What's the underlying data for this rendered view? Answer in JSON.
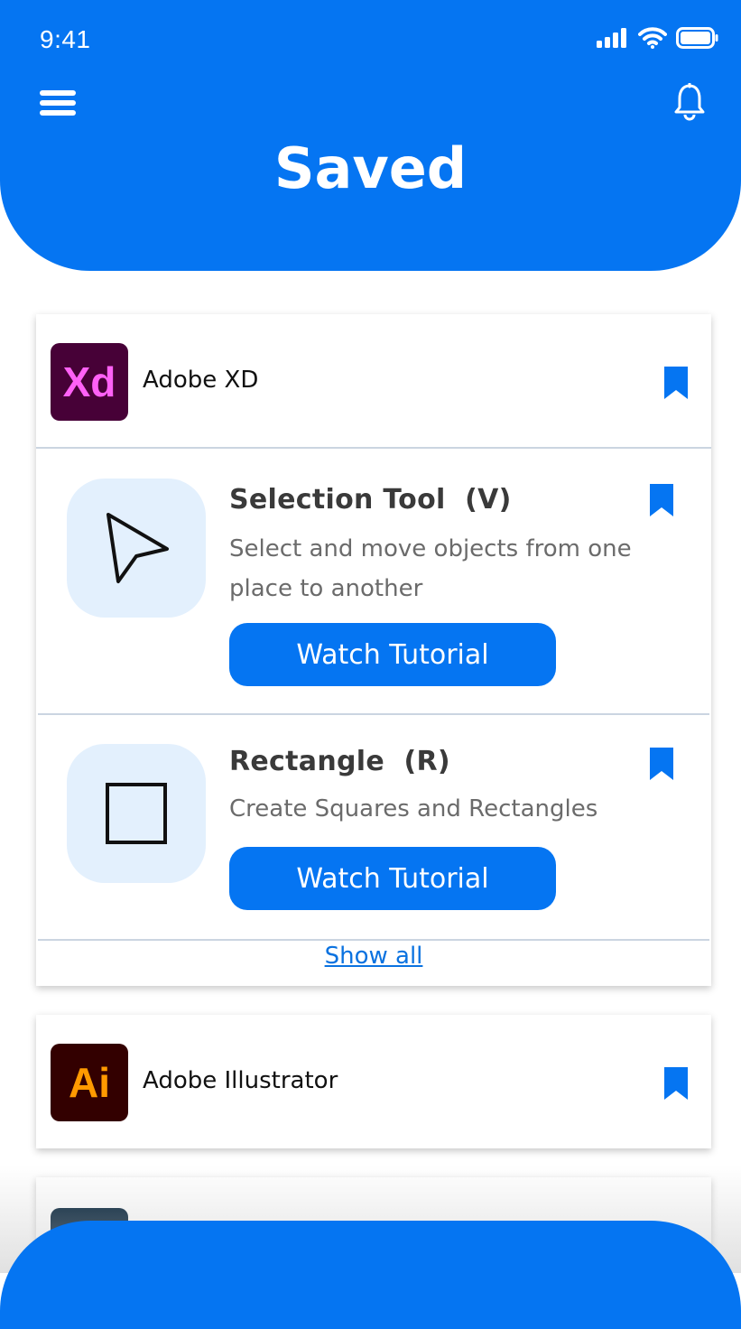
{
  "status_bar": {
    "time": "9:41"
  },
  "header": {
    "title": "Saved"
  },
  "colors": {
    "primary": "#0575f2",
    "icon_box": "#e3f0fd"
  },
  "apps": [
    {
      "name": "Adobe XD",
      "logo_text": "Xd",
      "tools": [
        {
          "title": "Selection Tool  (V)",
          "description": "Select and move objects from one place to another",
          "button_label": "Watch Tutorial",
          "icon": "cursor-arrow-icon"
        },
        {
          "title": "Rectangle  (R)",
          "description": "Create Squares and Rectangles",
          "button_label": "Watch Tutorial",
          "icon": "rectangle-icon"
        }
      ],
      "show_all_label": "Show all"
    },
    {
      "name": "Adobe Illustrator",
      "logo_text": "Ai"
    }
  ]
}
